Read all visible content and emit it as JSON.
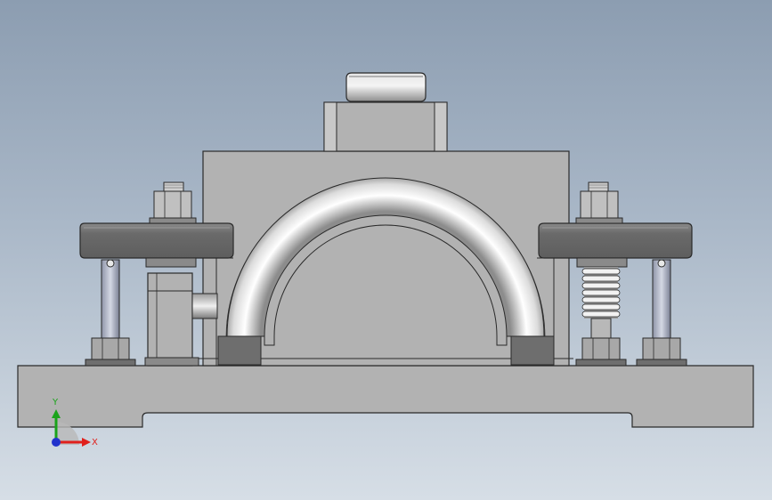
{
  "viewport": {
    "background_top": "#8c9db1",
    "background_bottom": "#d6dee6"
  },
  "colors": {
    "body_gray": "#b2b2b2",
    "body_edge": "#2a2a2a",
    "dark_block": "#6e6e6e",
    "axis_x": "#e0201c",
    "axis_y": "#1aa31a",
    "axis_z": "#2233cc"
  },
  "axis_triad": {
    "x_label": "X",
    "y_label": "Y"
  },
  "parts": [
    "base-plate",
    "bearing-housing",
    "top-cap",
    "top-cap-disk",
    "bearing-shell",
    "left-clamp-arm",
    "right-clamp-arm",
    "left-guide-rod",
    "right-guide-rod",
    "compression-spring",
    "hex-nut",
    "support-post"
  ]
}
